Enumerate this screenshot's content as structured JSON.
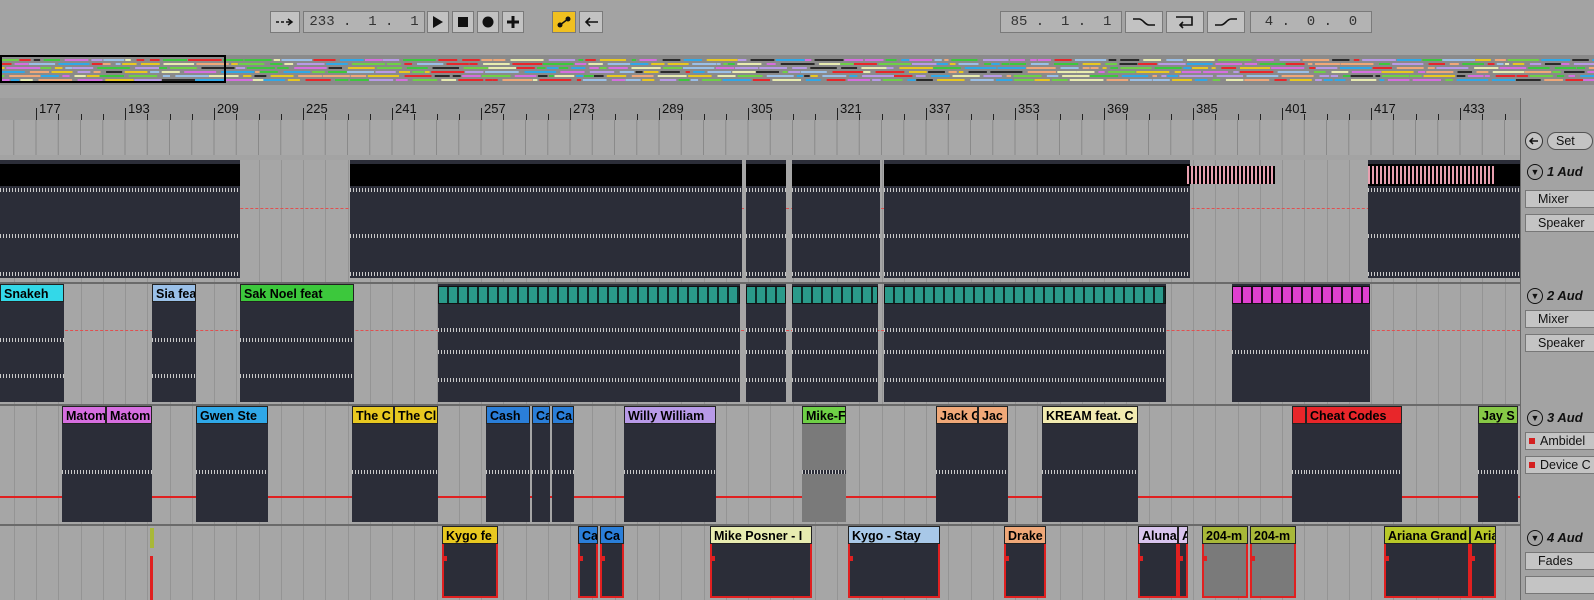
{
  "transport": {
    "follow_icon": "follow-arrow-icon",
    "arrangement_position": "233 .  1 .  1",
    "play_icon": "play-icon",
    "stop_icon": "stop-icon",
    "record_icon": "record-icon",
    "add_icon": "plus-icon",
    "automation_icon": "automation-arm-icon",
    "back_to_arrangement_icon": "back-arrow-icon",
    "loop_start": "85 .  1 .  1",
    "punch_in_icon": "punch-in-icon",
    "loop_icon": "loop-icon",
    "punch_out_icon": "punch-out-icon",
    "loop_length": "4 .  0 .  0",
    "accent_color": "#f0c020"
  },
  "ruler": {
    "bars": [
      "177",
      "193",
      "209",
      "225",
      "241",
      "257",
      "273",
      "289",
      "305",
      "321",
      "337",
      "353",
      "369",
      "385",
      "401",
      "417",
      "433"
    ]
  },
  "locators": {
    "set_label": "Set",
    "prev_icon": "prev-locator-icon"
  },
  "tracks": [
    {
      "name": "1 Aud",
      "routing_1": "Mixer",
      "routing_2": "Speaker",
      "clips": []
    },
    {
      "name": "2 Aud",
      "routing_1": "Mixer",
      "routing_2": "Speaker",
      "clips": [
        {
          "label": "Sia fea",
          "color": "#9ac0e8"
        },
        {
          "label": "Snakeh",
          "color": "#33d8e8"
        },
        {
          "label": "Sak Noel feat",
          "color": "#3cc83c"
        }
      ]
    },
    {
      "name": "3 Aud",
      "routing_1": "Ambidel",
      "routing_2": "Device C",
      "clips": [
        {
          "label": "Matom",
          "color": "#d66ee0"
        },
        {
          "label": "Matom",
          "color": "#d66ee0"
        },
        {
          "label": "Gwen Ste",
          "color": "#2fa8e8"
        },
        {
          "label": "The C",
          "color": "#e8c820"
        },
        {
          "label": "The Cl",
          "color": "#e8c820"
        },
        {
          "label": "Cash",
          "color": "#2a7ed8"
        },
        {
          "label": "Ca",
          "color": "#2a7ed8"
        },
        {
          "label": "Ca",
          "color": "#2a7ed8"
        },
        {
          "label": "Willy William",
          "color": "#b89ae8"
        },
        {
          "label": "Mike-F",
          "color": "#6ed046"
        },
        {
          "label": "Jack G",
          "color": "#f0a878"
        },
        {
          "label": "Jac",
          "color": "#f0a878"
        },
        {
          "label": "KREAM feat. C",
          "color": "#f2ebb0"
        },
        {
          "label": "Cheat Codes",
          "color": "#e8262a"
        },
        {
          "label": "Jay S",
          "color": "#86c846"
        }
      ]
    },
    {
      "name": "4 Aud",
      "routing_1": "Fades",
      "routing_2": "",
      "clips": [
        {
          "label": "Kygo fe",
          "color": "#e8c820"
        },
        {
          "label": "Ca",
          "color": "#2a7ed8"
        },
        {
          "label": "Ca",
          "color": "#2a7ed8"
        },
        {
          "label": "Mike Posner - I",
          "color": "#e8ecb0"
        },
        {
          "label": "Kygo - Stay",
          "color": "#a8c8e8"
        },
        {
          "label": "Drake",
          "color": "#f0a878"
        },
        {
          "label": "Aluna",
          "color": "#d8c4ee"
        },
        {
          "label": "A",
          "color": "#d8c4ee"
        },
        {
          "label": "204-m",
          "color": "#a8b838"
        },
        {
          "label": "204-m",
          "color": "#a8b838"
        },
        {
          "label": "Ariana Grand",
          "color": "#b8c828"
        },
        {
          "label": "Aria",
          "color": "#b8c828"
        }
      ]
    }
  ]
}
